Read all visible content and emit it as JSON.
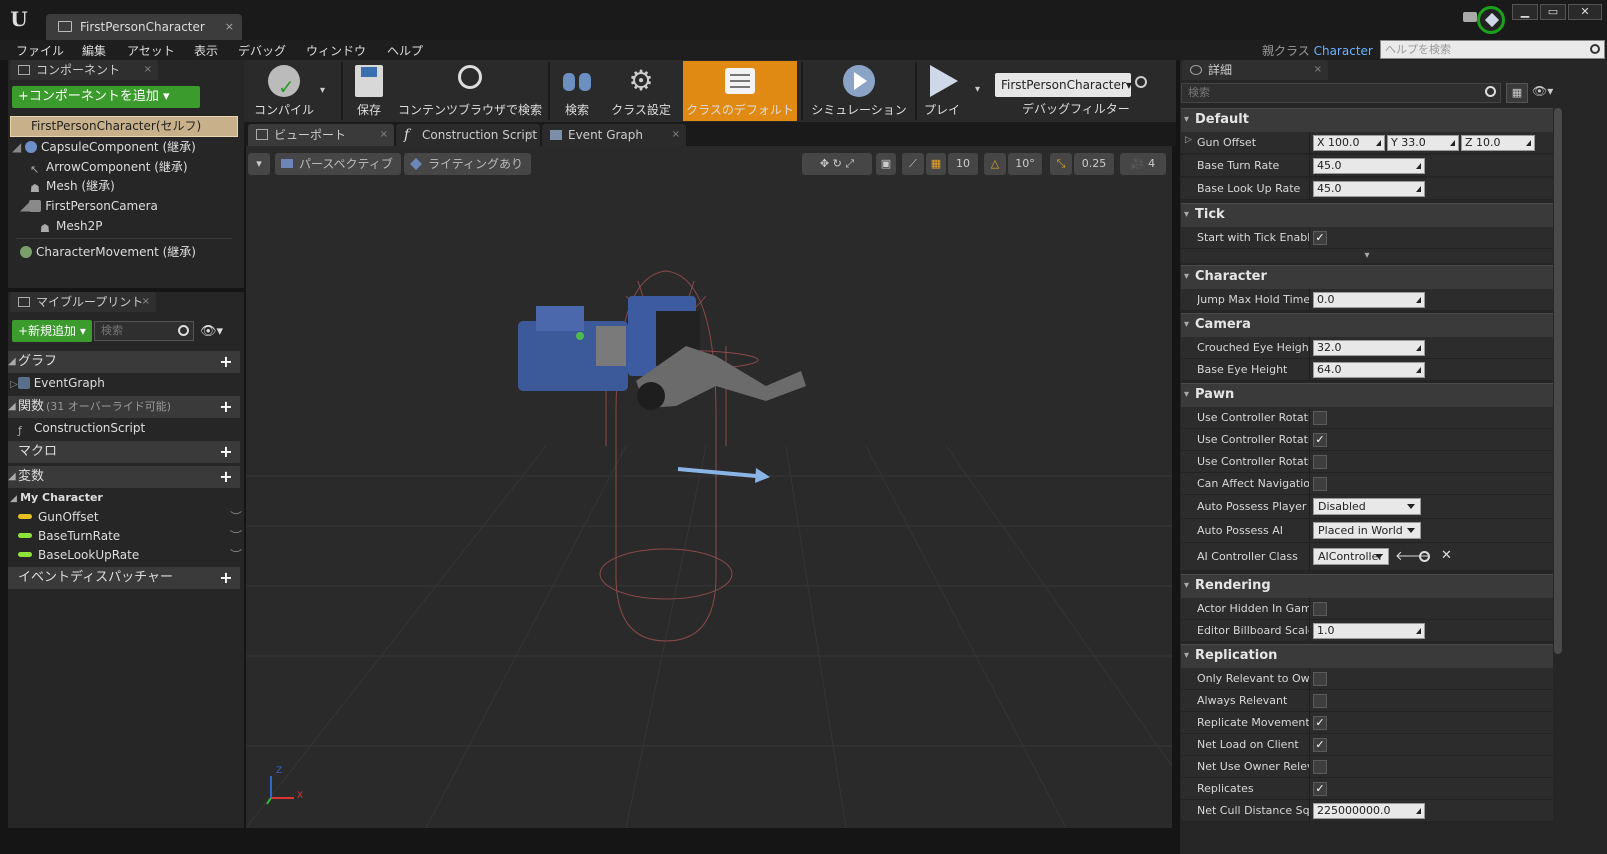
{
  "window": {
    "tab_title": "FirstPersonCharacter",
    "tab_close": "×",
    "controls": {
      "minimize": "▁",
      "maximize": "▭",
      "close": "✕"
    }
  },
  "menubar": {
    "items": [
      "ファイル",
      "編集",
      "アセット",
      "表示",
      "デバッグ",
      "ウィンドウ",
      "ヘルプ"
    ],
    "parent_class_label": "親クラス",
    "parent_class_value": "Character",
    "help_search_placeholder": "ヘルプを検索"
  },
  "components": {
    "tab_label": "コンポーネント",
    "add_button": "+コンポーネントを追加 ▾",
    "self_item": "FirstPersonCharacter(セルフ)",
    "tree": [
      {
        "label": "CapsuleComponent (継承)",
        "icon": "capsule-icon"
      },
      {
        "label": "ArrowComponent (継承)",
        "icon": "arrow-icon"
      },
      {
        "label": "Mesh (継承)",
        "icon": "skeletal-mesh-icon"
      },
      {
        "label": "FirstPersonCamera",
        "icon": "camera-icon"
      },
      {
        "label": "Mesh2P",
        "icon": "skeletal-mesh-icon"
      },
      {
        "label": "CharacterMovement (継承)",
        "icon": "movement-icon"
      }
    ]
  },
  "my_blueprint": {
    "tab_label": "マイブループリント",
    "add_new": "+新規追加 ▾",
    "search_placeholder": "検索",
    "sections": {
      "graph": "グラフ",
      "graph_item": "EventGraph",
      "functions": "関数",
      "functions_sub": "(31 オーバーライド可能)",
      "functions_item": "ConstructionScript",
      "macros": "マクロ",
      "variables": "変数",
      "variables_group": "My Character",
      "variables_items": [
        "GunOffset",
        "BaseTurnRate",
        "BaseLookUpRate"
      ],
      "event_dispatchers": "イベントディスパッチャー"
    }
  },
  "toolbar": {
    "buttons": [
      "コンパイル",
      "保存",
      "コンテンツブラウザで検索",
      "検索",
      "クラス設定",
      "クラスのデフォルト",
      "シミュレーション",
      "プレイ"
    ],
    "debug_dropdown": "FirstPersonCharacter▾",
    "debug_filter": "デバッグフィルター"
  },
  "editor_tabs": [
    "ビューポート",
    "Construction Script",
    "Event Graph"
  ],
  "viewport": {
    "perspective": "パースペクティブ",
    "lighting": "ライティングあり",
    "grid_snap": "10",
    "rotation_snap": "10°",
    "scale_snap": "0.25",
    "camera_speed": "4",
    "axis_x": "X",
    "axis_z": "Z"
  },
  "details": {
    "tab_label": "詳細",
    "search_placeholder": "検索",
    "categories": {
      "default": "Default",
      "tick": "Tick",
      "character": "Character",
      "camera": "Camera",
      "pawn": "Pawn",
      "rendering": "Rendering",
      "replication": "Replication"
    },
    "gun_offset": {
      "label": "Gun Offset",
      "x_label": "X",
      "x": "100.0",
      "y_label": "Y",
      "y": "33.0",
      "z_label": "Z",
      "z": "10.0"
    },
    "base_turn_rate": {
      "label": "Base Turn Rate",
      "value": "45.0"
    },
    "base_look_up_rate": {
      "label": "Base Look Up Rate",
      "value": "45.0"
    },
    "start_with_tick": {
      "label": "Start with Tick Enabled",
      "checked": true
    },
    "jump_max_hold": {
      "label": "Jump Max Hold Time",
      "value": "0.0"
    },
    "crouched_eye": {
      "label": "Crouched Eye Height",
      "value": "32.0"
    },
    "base_eye": {
      "label": "Base Eye Height",
      "value": "64.0"
    },
    "pawn_rows": [
      {
        "label": "Use Controller Rotation Pitch",
        "checked": false
      },
      {
        "label": "Use Controller Rotation Yaw",
        "checked": true
      },
      {
        "label": "Use Controller Rotation Roll",
        "checked": false
      },
      {
        "label": "Can Affect Navigation Generation",
        "checked": false
      }
    ],
    "auto_possess_player": {
      "label": "Auto Possess Player",
      "value": "Disabled"
    },
    "auto_possess_ai": {
      "label": "Auto Possess AI",
      "value": "Placed in World"
    },
    "ai_controller_class": {
      "label": "AI Controller Class",
      "value": "AIController"
    },
    "actor_hidden": {
      "label": "Actor Hidden In Game",
      "checked": false
    },
    "billboard_scale": {
      "label": "Editor Billboard Scale",
      "value": "1.0"
    },
    "replication_rows": [
      {
        "label": "Only Relevant to Owner",
        "checked": false
      },
      {
        "label": "Always Relevant",
        "checked": false
      },
      {
        "label": "Replicate Movement",
        "checked": true
      },
      {
        "label": "Net Load on Client",
        "checked": true
      },
      {
        "label": "Net Use Owner Relevancy",
        "checked": false
      },
      {
        "label": "Replicates",
        "checked": true
      }
    ],
    "net_cull": {
      "label": "Net Cull Distance Squared",
      "value": "225000000.0"
    }
  }
}
